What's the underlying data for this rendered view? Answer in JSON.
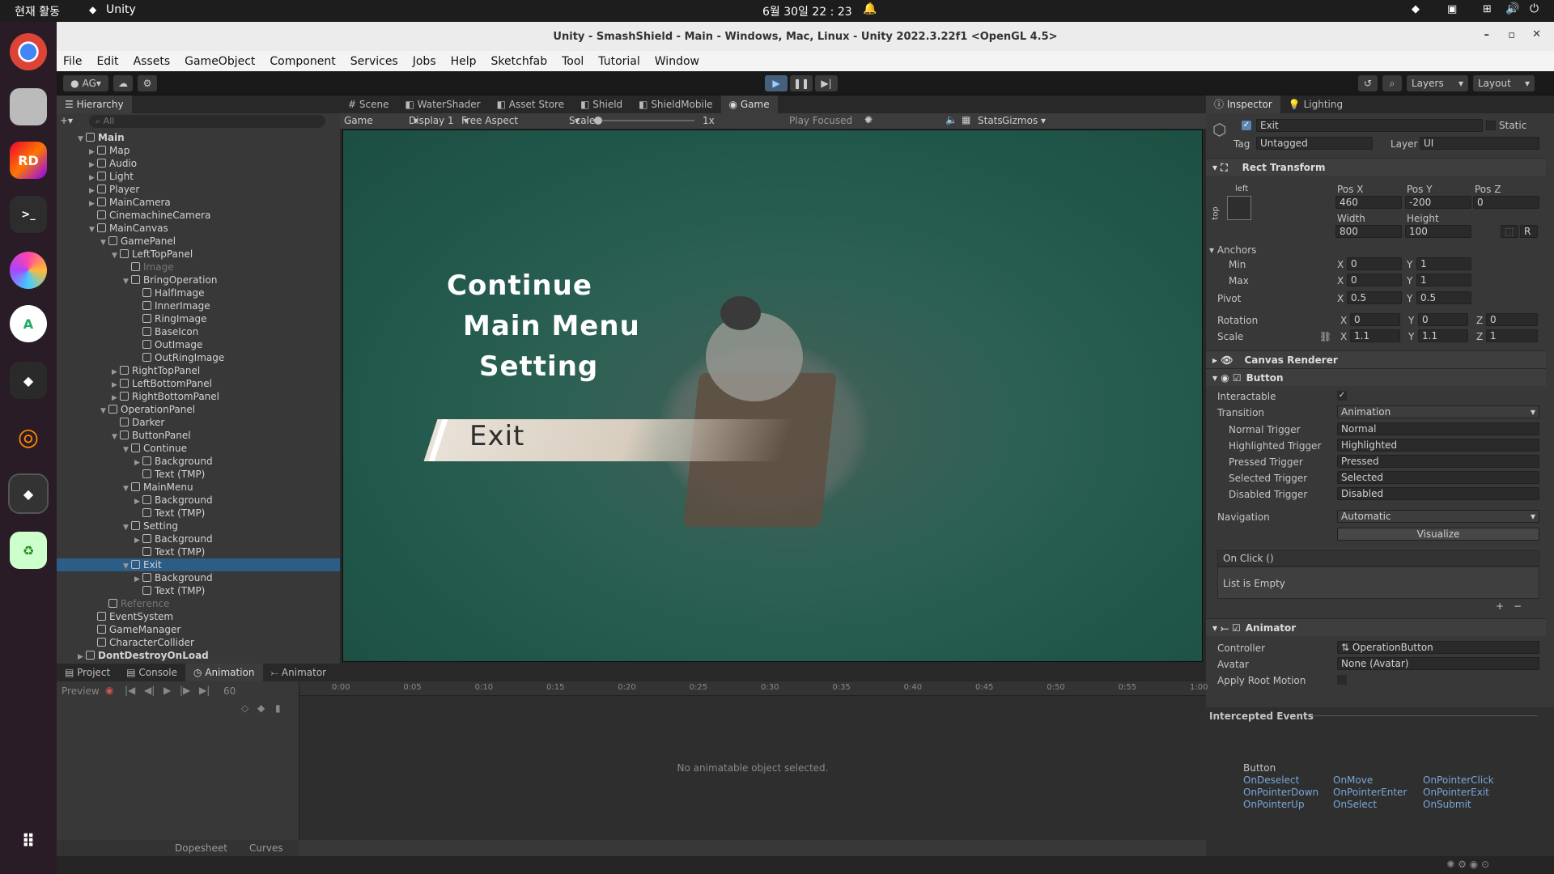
{
  "os": {
    "activities": "현재 활동",
    "app": "Unity",
    "clock": "6월 30일  22 : 23"
  },
  "window": {
    "title": "Unity - SmashShield - Main - Windows, Mac, Linux - Unity 2022.3.22f1 <OpenGL 4.5>"
  },
  "menu": [
    "File",
    "Edit",
    "Assets",
    "GameObject",
    "Component",
    "Services",
    "Jobs",
    "Help",
    "Sketchfab",
    "Tool",
    "Tutorial",
    "Window"
  ],
  "toolbar": {
    "account": "AG",
    "layers": "Layers",
    "layout": "Layout"
  },
  "hierarchy": {
    "tab": "Hierarchy",
    "search": "All",
    "rows": [
      {
        "t": "Main",
        "d": 0,
        "exp": "open",
        "scene": true
      },
      {
        "t": "Map",
        "d": 1,
        "exp": "closed"
      },
      {
        "t": "Audio",
        "d": 1,
        "exp": "closed"
      },
      {
        "t": "Light",
        "d": 1,
        "exp": "closed"
      },
      {
        "t": "Player",
        "d": 1,
        "exp": "closed"
      },
      {
        "t": "MainCamera",
        "d": 1,
        "exp": "closed"
      },
      {
        "t": "CinemachineCamera",
        "d": 1,
        "exp": ""
      },
      {
        "t": "MainCanvas",
        "d": 1,
        "exp": "open"
      },
      {
        "t": "GamePanel",
        "d": 2,
        "exp": "open"
      },
      {
        "t": "LeftTopPanel",
        "d": 3,
        "exp": "open"
      },
      {
        "t": "Image",
        "d": 4,
        "exp": "",
        "dim": true
      },
      {
        "t": "BringOperation",
        "d": 4,
        "exp": "open"
      },
      {
        "t": "HalfImage",
        "d": 5,
        "exp": ""
      },
      {
        "t": "InnerImage",
        "d": 5,
        "exp": ""
      },
      {
        "t": "RingImage",
        "d": 5,
        "exp": ""
      },
      {
        "t": "BaseIcon",
        "d": 5,
        "exp": ""
      },
      {
        "t": "OutImage",
        "d": 5,
        "exp": ""
      },
      {
        "t": "OutRingImage",
        "d": 5,
        "exp": ""
      },
      {
        "t": "RightTopPanel",
        "d": 3,
        "exp": "closed"
      },
      {
        "t": "LeftBottomPanel",
        "d": 3,
        "exp": "closed"
      },
      {
        "t": "RightBottomPanel",
        "d": 3,
        "exp": "closed"
      },
      {
        "t": "OperationPanel",
        "d": 2,
        "exp": "open"
      },
      {
        "t": "Darker",
        "d": 3,
        "exp": ""
      },
      {
        "t": "ButtonPanel",
        "d": 3,
        "exp": "open"
      },
      {
        "t": "Continue",
        "d": 4,
        "exp": "open"
      },
      {
        "t": "Background",
        "d": 5,
        "exp": "closed"
      },
      {
        "t": "Text (TMP)",
        "d": 5,
        "exp": ""
      },
      {
        "t": "MainMenu",
        "d": 4,
        "exp": "open"
      },
      {
        "t": "Background",
        "d": 5,
        "exp": "closed"
      },
      {
        "t": "Text (TMP)",
        "d": 5,
        "exp": ""
      },
      {
        "t": "Setting",
        "d": 4,
        "exp": "open"
      },
      {
        "t": "Background",
        "d": 5,
        "exp": "closed"
      },
      {
        "t": "Text (TMP)",
        "d": 5,
        "exp": ""
      },
      {
        "t": "Exit",
        "d": 4,
        "exp": "open",
        "sel": true
      },
      {
        "t": "Background",
        "d": 5,
        "exp": "closed"
      },
      {
        "t": "Text (TMP)",
        "d": 5,
        "exp": ""
      },
      {
        "t": "Reference",
        "d": 2,
        "exp": "",
        "dim": true
      },
      {
        "t": "EventSystem",
        "d": 1,
        "exp": ""
      },
      {
        "t": "GameManager",
        "d": 1,
        "exp": ""
      },
      {
        "t": "CharacterCollider",
        "d": 1,
        "exp": ""
      },
      {
        "t": "DontDestroyOnLoad",
        "d": 0,
        "exp": "closed",
        "scene": true
      }
    ]
  },
  "viewtabs": [
    "Scene",
    "WaterShader",
    "Asset Store",
    "Shield",
    "ShieldMobile",
    "Game"
  ],
  "gamebar": {
    "mode": "Game",
    "display": "Display 1",
    "aspect": "Free Aspect",
    "scale_label": "Scale",
    "scale": "1x",
    "play": "Play Focused",
    "stats": "Stats",
    "gizmos": "Gizmos"
  },
  "game": {
    "items": [
      "Continue",
      "Main Menu",
      "Setting",
      "Exit"
    ],
    "selected": "Exit"
  },
  "inspector": {
    "tabs": [
      "Inspector",
      "Lighting"
    ],
    "name": "Exit",
    "static": "Static",
    "tag_label": "Tag",
    "tag": "Untagged",
    "layer_label": "Layer",
    "layer": "UI",
    "rect": {
      "title": "Rect Transform",
      "left": "left",
      "top": "top",
      "posx_l": "Pos X",
      "posy_l": "Pos Y",
      "posz_l": "Pos Z",
      "posx": "460",
      "posy": "-200",
      "posz": "0",
      "w_l": "Width",
      "h_l": "Height",
      "w": "800",
      "h": "100",
      "r": "R",
      "anchors": "Anchors",
      "min": "Min",
      "max": "Max",
      "pivot": "Pivot",
      "minx": "0",
      "miny": "1",
      "maxx": "0",
      "maxy": "1",
      "pivx": "0.5",
      "pivy": "0.5",
      "rotation": "Rotation",
      "scale": "Scale",
      "rx": "0",
      "ry": "0",
      "rz": "0",
      "sx": "1.1",
      "sy": "1.1",
      "sz": "1"
    },
    "canvas_renderer": "Canvas Renderer",
    "button": {
      "title": "Button",
      "interactable": "Interactable",
      "transition_l": "Transition",
      "transition": "Animation",
      "triggers": [
        [
          "Normal Trigger",
          "Normal"
        ],
        [
          "Highlighted Trigger",
          "Highlighted"
        ],
        [
          "Pressed Trigger",
          "Pressed"
        ],
        [
          "Selected Trigger",
          "Selected"
        ],
        [
          "Disabled Trigger",
          "Disabled"
        ]
      ],
      "navigation_l": "Navigation",
      "navigation": "Automatic",
      "visualize": "Visualize",
      "onclick": "On Click ()",
      "empty": "List is Empty"
    },
    "animator": {
      "title": "Animator",
      "controller_l": "Controller",
      "controller": "OperationButton",
      "avatar_l": "Avatar",
      "avatar": "None (Avatar)",
      "rootmotion": "Apply Root Motion"
    },
    "intercepted": "Intercepted Events",
    "events": {
      "head": "Button",
      "list": [
        "OnDeselect",
        "OnMove",
        "OnPointerClick",
        "OnPointerDown",
        "OnPointerEnter",
        "OnPointerExit",
        "OnPointerUp",
        "OnSelect",
        "OnSubmit"
      ]
    }
  },
  "bottom": {
    "tabs": [
      "Project",
      "Console",
      "Animation",
      "Animator"
    ],
    "preview": "Preview",
    "frame": "60",
    "ticks": [
      "0:00",
      "0:05",
      "0:10",
      "0:15",
      "0:20",
      "0:25",
      "0:30",
      "0:35",
      "0:40",
      "0:45",
      "0:50",
      "0:55",
      "1:00"
    ],
    "empty": "No animatable object selected.",
    "dopesheet": "Dopesheet",
    "curves": "Curves"
  }
}
